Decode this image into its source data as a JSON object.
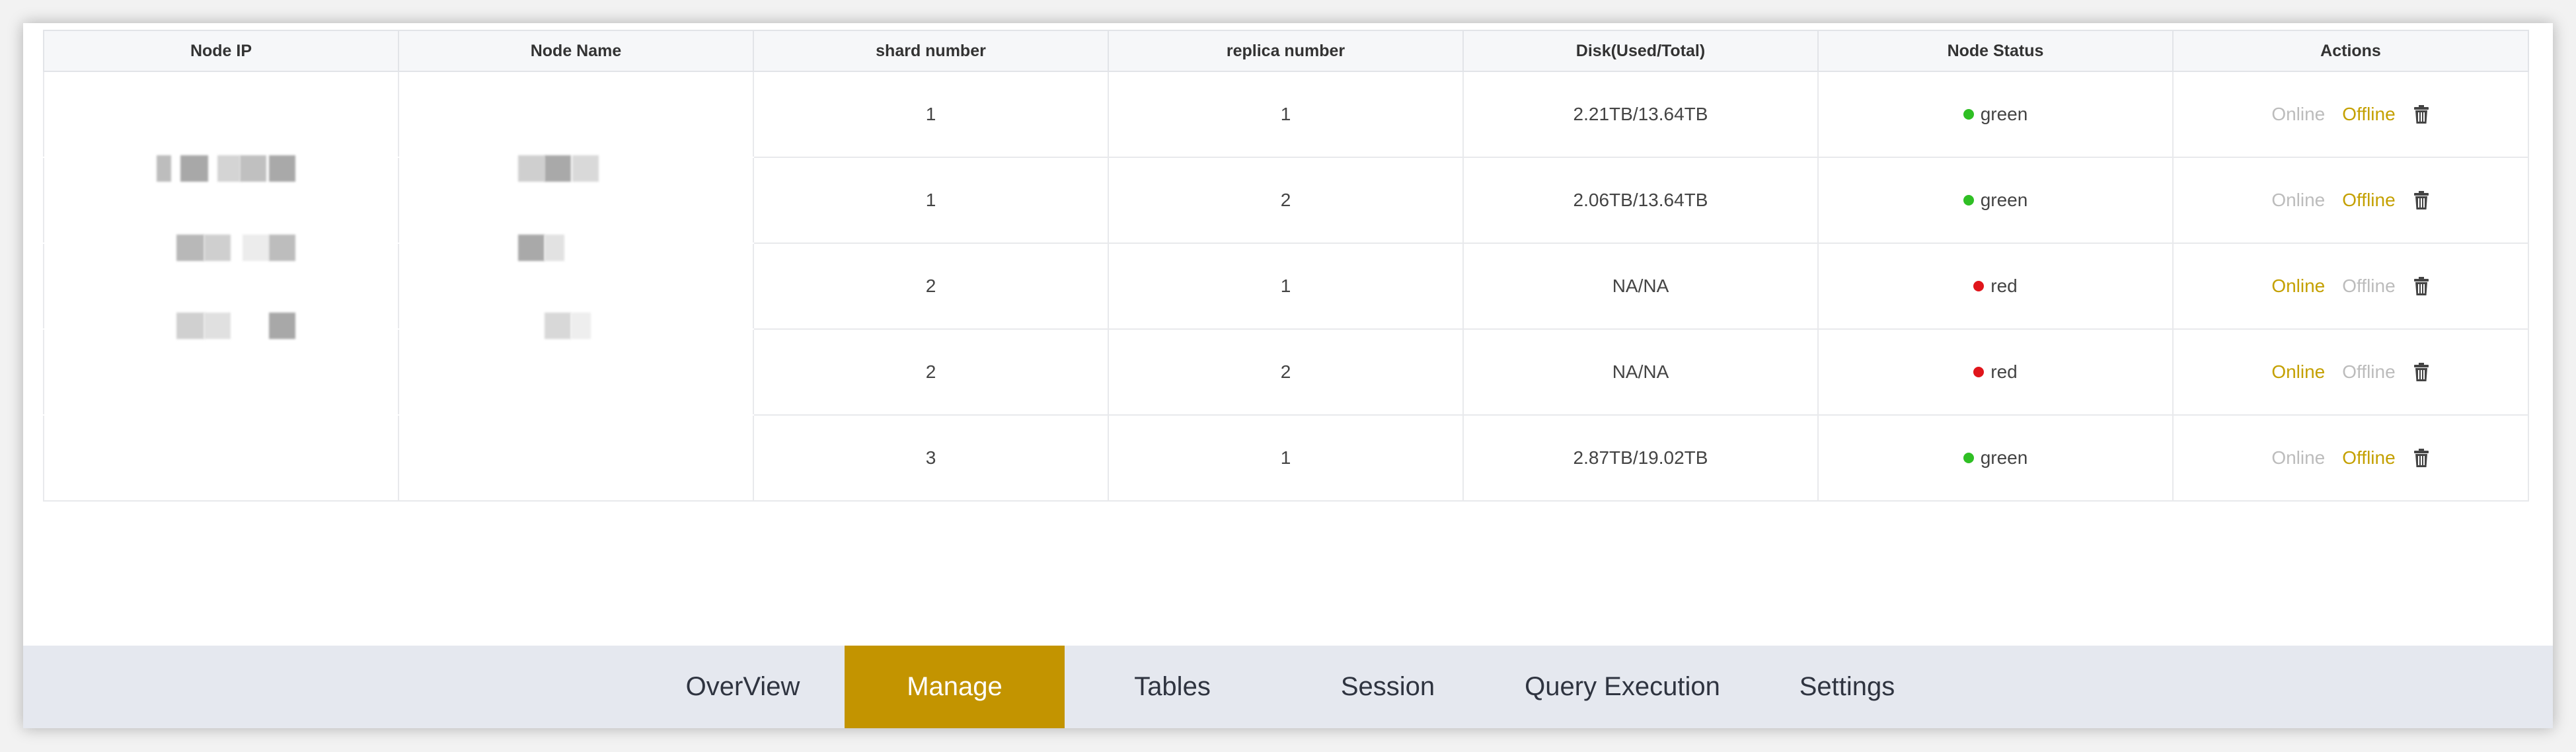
{
  "table": {
    "headers": [
      "Node IP",
      "Node Name",
      "shard number",
      "replica number",
      "Disk(Used/Total)",
      "Node Status",
      "Actions"
    ],
    "rows": [
      {
        "shard": "1",
        "replica": "1",
        "disk": "2.21TB/13.64TB",
        "status": "green",
        "status_color": "#2fbf24",
        "online_enabled": false,
        "offline_enabled": true
      },
      {
        "shard": "1",
        "replica": "2",
        "disk": "2.06TB/13.64TB",
        "status": "green",
        "status_color": "#2fbf24",
        "online_enabled": false,
        "offline_enabled": true
      },
      {
        "shard": "2",
        "replica": "1",
        "disk": "NA/NA",
        "status": "red",
        "status_color": "#e0151b",
        "online_enabled": true,
        "offline_enabled": false
      },
      {
        "shard": "2",
        "replica": "2",
        "disk": "NA/NA",
        "status": "red",
        "status_color": "#e0151b",
        "online_enabled": true,
        "offline_enabled": false
      },
      {
        "shard": "3",
        "replica": "1",
        "disk": "2.87TB/19.02TB",
        "status": "green",
        "status_color": "#2fbf24",
        "online_enabled": false,
        "offline_enabled": true
      }
    ],
    "action_labels": {
      "online": "Online",
      "offline": "Offline",
      "delete_icon": "trash-icon"
    }
  },
  "nav": {
    "tabs": [
      "OverView",
      "Manage",
      "Tables",
      "Session",
      "Query Execution",
      "Settings"
    ],
    "active": "Manage"
  },
  "colors": {
    "accent": "#c39400",
    "nav_bg": "#e5e8ef",
    "enabled_action": "#c4a000",
    "disabled_action": "#bcbcbc",
    "status_green": "#2fbf24",
    "status_red": "#e0151b"
  }
}
